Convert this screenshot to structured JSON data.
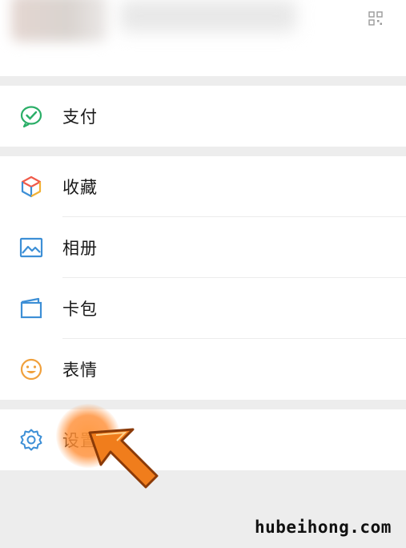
{
  "menu": {
    "pay": {
      "label": "支付",
      "icon": "wechat-pay-icon"
    },
    "favorites": {
      "label": "收藏",
      "icon": "cube-icon"
    },
    "album": {
      "label": "相册",
      "icon": "image-icon"
    },
    "cards": {
      "label": "卡包",
      "icon": "wallet-icon"
    },
    "stickers": {
      "label": "表情",
      "icon": "smile-icon"
    },
    "settings": {
      "label": "设置",
      "icon": "gear-icon"
    }
  },
  "profile": {
    "qr_icon": "qr-code-icon"
  },
  "watermark": "hubeihong.com",
  "colors": {
    "green": "#2aae67",
    "blue": "#3d8fd6",
    "orange": "#f0a03c",
    "arrow": "#f07d1c"
  }
}
